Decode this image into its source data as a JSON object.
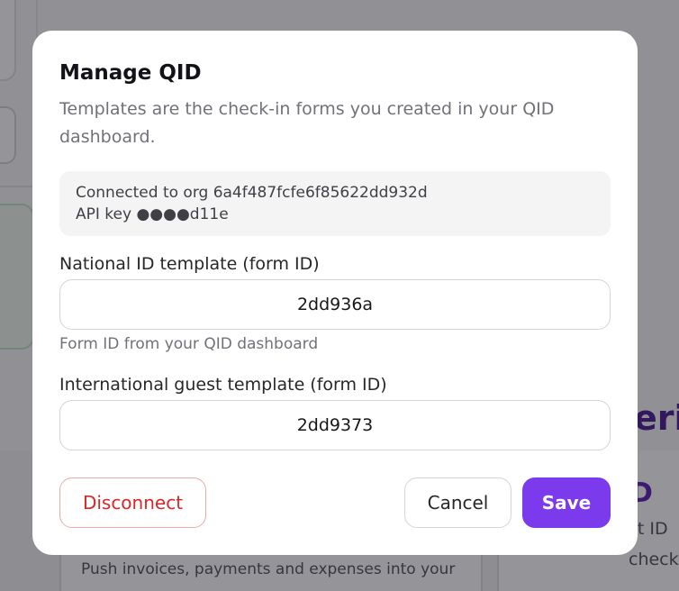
{
  "background": {
    "card_text": "Push invoices, payments and expenses into your",
    "heading_fragment": "erifi",
    "side_letter": "D",
    "side_line_1": "st ID",
    "side_line_2": "check-in"
  },
  "modal": {
    "title": "Manage QID",
    "subtitle": "Templates are the check-in forms you created in your QID dashboard.",
    "connection": {
      "org_line": "Connected to org 6a4f487fcfe6f85622dd932d",
      "api_key_line": "API key ●●●●d11e"
    },
    "national_template": {
      "label": "National ID template (form ID)",
      "value": "2dd936a",
      "hint": "Form ID from your QID dashboard"
    },
    "international_template": {
      "label": "International guest template (form ID)",
      "value": "2dd9373"
    },
    "buttons": {
      "disconnect": "Disconnect",
      "cancel": "Cancel",
      "save": "Save"
    }
  },
  "colors": {
    "accent": "#7c3aed",
    "danger": "#dc2626",
    "overlay": "rgba(20,20,28,0.45)"
  }
}
